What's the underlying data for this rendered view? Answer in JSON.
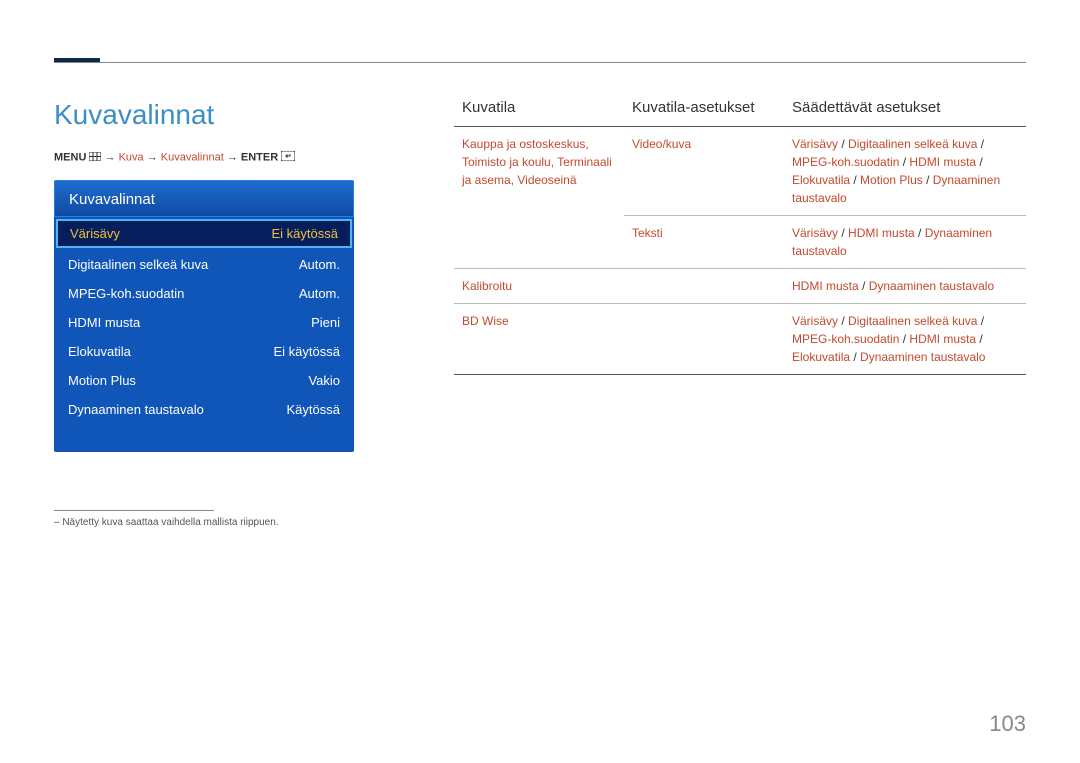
{
  "page_title": "Kuvavalinnat",
  "breadcrumb": {
    "menu_label": "MENU",
    "arrow": "→",
    "path1": "Kuva",
    "path2": "Kuvavalinnat",
    "enter_label": "ENTER"
  },
  "menu_panel": {
    "header": "Kuvavalinnat",
    "rows": [
      {
        "label": "Värisävy",
        "value": "Ei käytössä",
        "selected": true
      },
      {
        "label": "Digitaalinen selkeä kuva",
        "value": "Autom.",
        "selected": false
      },
      {
        "label": "MPEG-koh.suodatin",
        "value": "Autom.",
        "selected": false
      },
      {
        "label": "HDMI musta",
        "value": "Pieni",
        "selected": false
      },
      {
        "label": "Elokuvatila",
        "value": "Ei käytössä",
        "selected": false
      },
      {
        "label": "Motion Plus",
        "value": "Vakio",
        "selected": false
      },
      {
        "label": "Dynaaminen taustavalo",
        "value": "Käytössä",
        "selected": false
      }
    ]
  },
  "footnote": "– Näytetty kuva saattaa vaihdella mallista riippuen.",
  "table": {
    "headers": [
      "Kuvatila",
      "Kuvatila-asetukset",
      "Säädettävät asetukset"
    ],
    "rows": [
      {
        "col1": "Kauppa ja ostoskeskus, Toimisto ja koulu, Terminaali ja asema, Videoseinä",
        "col2": "Video/kuva",
        "col3_parts": [
          "Värisävy",
          " / ",
          "Digitaalinen selkeä kuva",
          " / ",
          "MPEG-koh.suodatin",
          " / ",
          "HDMI musta",
          " / ",
          "Elokuvatila",
          " / ",
          "Motion Plus",
          " / ",
          "Dynaaminen taustavalo"
        ]
      },
      {
        "col1": "",
        "col2": "Teksti",
        "col3_parts": [
          "Värisävy",
          " / ",
          "HDMI musta",
          " / ",
          "Dynaaminen taustavalo"
        ]
      },
      {
        "col1": "Kalibroitu",
        "col2": "",
        "col3_parts": [
          "HDMI musta",
          " / ",
          "Dynaaminen taustavalo"
        ]
      },
      {
        "col1": "BD Wise",
        "col2": "",
        "col3_parts": [
          "Värisävy",
          " / ",
          "Digitaalinen selkeä kuva",
          " / ",
          "MPEG-koh.suodatin",
          " / ",
          "HDMI musta",
          " / ",
          "Elokuvatila",
          " / ",
          "Dynaaminen taustavalo"
        ]
      }
    ]
  },
  "page_number": "103"
}
